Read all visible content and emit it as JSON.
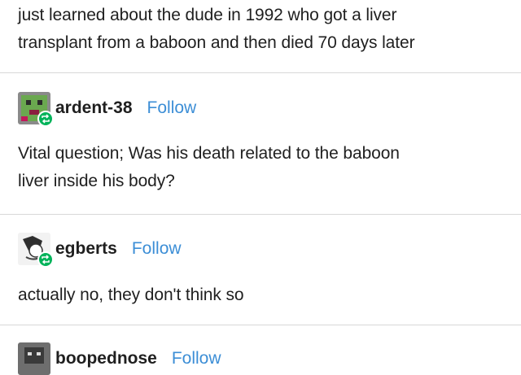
{
  "posts": [
    {
      "username": "",
      "follow_label": "",
      "lines": [
        "just learned about the dude in 1992 who got a liver",
        "transplant from a baboon and then died 70 days later"
      ],
      "avatar_icon": "none"
    },
    {
      "username": "ardent-38",
      "follow_label": "Follow",
      "lines": [
        "Vital question; Was his death related to the baboon",
        "liver inside his body?"
      ],
      "avatar_icon": "pixel-art-creature-avatar",
      "avatar_color": "#6aa84f"
    },
    {
      "username": "egberts",
      "follow_label": "Follow",
      "lines": [
        "actually no, they don't think so"
      ],
      "avatar_icon": "sketch-character-avatar",
      "avatar_color": "#444444"
    },
    {
      "username": "boopednose",
      "follow_label": "Follow",
      "lines": [],
      "avatar_icon": "photo-face-avatar",
      "avatar_color": "#555555"
    }
  ],
  "colors": {
    "follow_link": "#3c8ed6",
    "reblog_badge": "#00b35a",
    "divider": "#d8d8d8",
    "text": "#1f1f1f"
  }
}
